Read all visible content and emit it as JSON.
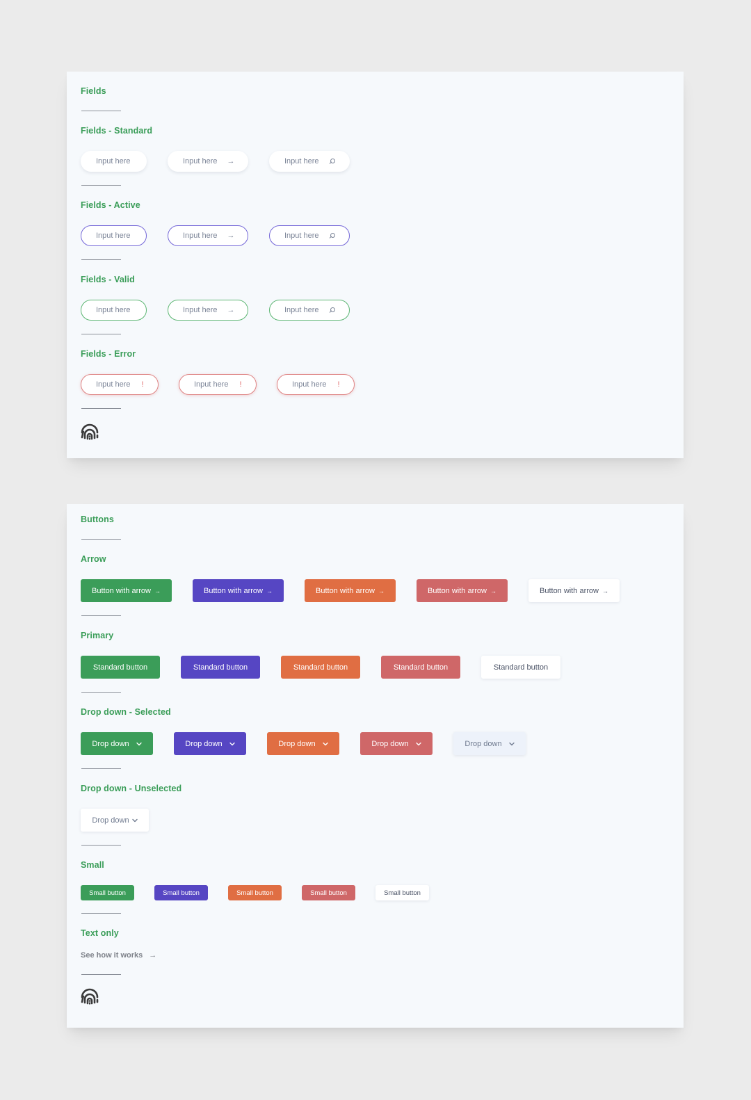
{
  "colors": {
    "background": "#ebebeb",
    "card": "#f6f9fc",
    "heading": "#3a9d58",
    "green": "#3b9d59",
    "purple": "#5646c3",
    "orange": "#e06e43",
    "red": "#cf6768",
    "active_border": "#7467d8",
    "valid_border": "#5cb672",
    "error_border": "#df8585"
  },
  "fields_card": {
    "title": "Fields",
    "sections": [
      {
        "title": "Fields - Standard",
        "state": "standard",
        "inputs": [
          {
            "placeholder": "Input here",
            "icon": ""
          },
          {
            "placeholder": "Input here",
            "icon": "arrow-right-icon"
          },
          {
            "placeholder": "Input here",
            "icon": "search-icon"
          }
        ]
      },
      {
        "title": "Fields - Active",
        "state": "active",
        "inputs": [
          {
            "placeholder": "Input here",
            "icon": ""
          },
          {
            "placeholder": "Input here",
            "icon": "arrow-right-icon"
          },
          {
            "placeholder": "Input here",
            "icon": "search-icon"
          }
        ]
      },
      {
        "title": "Fields - Valid",
        "state": "valid",
        "inputs": [
          {
            "placeholder": "Input here",
            "icon": ""
          },
          {
            "placeholder": "Input here",
            "icon": "arrow-right-icon"
          },
          {
            "placeholder": "Input here",
            "icon": "search-icon"
          }
        ]
      },
      {
        "title": "Fields - Error",
        "state": "error",
        "inputs": [
          {
            "placeholder": "Input here",
            "icon": "exclamation-icon"
          },
          {
            "placeholder": "Input here",
            "icon": "exclamation-icon"
          },
          {
            "placeholder": "Input here",
            "icon": "exclamation-icon"
          }
        ]
      }
    ],
    "icon_arrow": "→",
    "icon_error": "!",
    "footer_icon": "fingerprint-icon"
  },
  "buttons_card": {
    "title": "Buttons",
    "arrow": {
      "title": "Arrow",
      "label": "Button with arrow",
      "arrow_glyph": "→",
      "variants": [
        "green",
        "purple",
        "orange",
        "red",
        "white"
      ]
    },
    "primary": {
      "title": "Primary",
      "label": "Standard button",
      "variants": [
        "green",
        "purple",
        "orange",
        "red",
        "white"
      ]
    },
    "dropdown_selected": {
      "title": "Drop down - Selected",
      "label": "Drop down",
      "variants": [
        "green",
        "purple",
        "orange",
        "red",
        "ghost"
      ]
    },
    "dropdown_unselected": {
      "title": "Drop down - Unselected",
      "label": "Drop down"
    },
    "small": {
      "title": "Small",
      "label": "Small button",
      "variants": [
        "green",
        "purple",
        "orange",
        "red",
        "white"
      ]
    },
    "text_only": {
      "title": "Text only",
      "label": "See how it works",
      "arrow_glyph": "→"
    },
    "footer_icon": "fingerprint-icon"
  }
}
